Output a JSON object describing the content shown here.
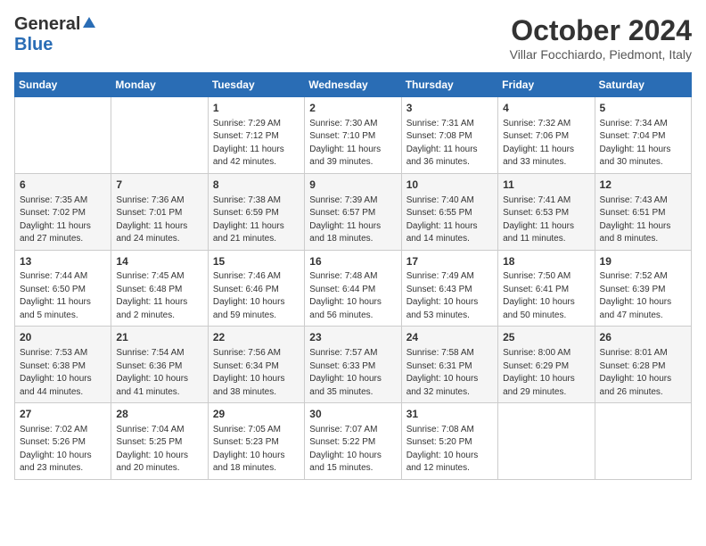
{
  "logo": {
    "general": "General",
    "blue": "Blue"
  },
  "title": "October 2024",
  "location": "Villar Focchiardo, Piedmont, Italy",
  "days_of_week": [
    "Sunday",
    "Monday",
    "Tuesday",
    "Wednesday",
    "Thursday",
    "Friday",
    "Saturday"
  ],
  "weeks": [
    [
      {
        "day": "",
        "info": ""
      },
      {
        "day": "",
        "info": ""
      },
      {
        "day": "1",
        "info": "Sunrise: 7:29 AM\nSunset: 7:12 PM\nDaylight: 11 hours and 42 minutes."
      },
      {
        "day": "2",
        "info": "Sunrise: 7:30 AM\nSunset: 7:10 PM\nDaylight: 11 hours and 39 minutes."
      },
      {
        "day": "3",
        "info": "Sunrise: 7:31 AM\nSunset: 7:08 PM\nDaylight: 11 hours and 36 minutes."
      },
      {
        "day": "4",
        "info": "Sunrise: 7:32 AM\nSunset: 7:06 PM\nDaylight: 11 hours and 33 minutes."
      },
      {
        "day": "5",
        "info": "Sunrise: 7:34 AM\nSunset: 7:04 PM\nDaylight: 11 hours and 30 minutes."
      }
    ],
    [
      {
        "day": "6",
        "info": "Sunrise: 7:35 AM\nSunset: 7:02 PM\nDaylight: 11 hours and 27 minutes."
      },
      {
        "day": "7",
        "info": "Sunrise: 7:36 AM\nSunset: 7:01 PM\nDaylight: 11 hours and 24 minutes."
      },
      {
        "day": "8",
        "info": "Sunrise: 7:38 AM\nSunset: 6:59 PM\nDaylight: 11 hours and 21 minutes."
      },
      {
        "day": "9",
        "info": "Sunrise: 7:39 AM\nSunset: 6:57 PM\nDaylight: 11 hours and 18 minutes."
      },
      {
        "day": "10",
        "info": "Sunrise: 7:40 AM\nSunset: 6:55 PM\nDaylight: 11 hours and 14 minutes."
      },
      {
        "day": "11",
        "info": "Sunrise: 7:41 AM\nSunset: 6:53 PM\nDaylight: 11 hours and 11 minutes."
      },
      {
        "day": "12",
        "info": "Sunrise: 7:43 AM\nSunset: 6:51 PM\nDaylight: 11 hours and 8 minutes."
      }
    ],
    [
      {
        "day": "13",
        "info": "Sunrise: 7:44 AM\nSunset: 6:50 PM\nDaylight: 11 hours and 5 minutes."
      },
      {
        "day": "14",
        "info": "Sunrise: 7:45 AM\nSunset: 6:48 PM\nDaylight: 11 hours and 2 minutes."
      },
      {
        "day": "15",
        "info": "Sunrise: 7:46 AM\nSunset: 6:46 PM\nDaylight: 10 hours and 59 minutes."
      },
      {
        "day": "16",
        "info": "Sunrise: 7:48 AM\nSunset: 6:44 PM\nDaylight: 10 hours and 56 minutes."
      },
      {
        "day": "17",
        "info": "Sunrise: 7:49 AM\nSunset: 6:43 PM\nDaylight: 10 hours and 53 minutes."
      },
      {
        "day": "18",
        "info": "Sunrise: 7:50 AM\nSunset: 6:41 PM\nDaylight: 10 hours and 50 minutes."
      },
      {
        "day": "19",
        "info": "Sunrise: 7:52 AM\nSunset: 6:39 PM\nDaylight: 10 hours and 47 minutes."
      }
    ],
    [
      {
        "day": "20",
        "info": "Sunrise: 7:53 AM\nSunset: 6:38 PM\nDaylight: 10 hours and 44 minutes."
      },
      {
        "day": "21",
        "info": "Sunrise: 7:54 AM\nSunset: 6:36 PM\nDaylight: 10 hours and 41 minutes."
      },
      {
        "day": "22",
        "info": "Sunrise: 7:56 AM\nSunset: 6:34 PM\nDaylight: 10 hours and 38 minutes."
      },
      {
        "day": "23",
        "info": "Sunrise: 7:57 AM\nSunset: 6:33 PM\nDaylight: 10 hours and 35 minutes."
      },
      {
        "day": "24",
        "info": "Sunrise: 7:58 AM\nSunset: 6:31 PM\nDaylight: 10 hours and 32 minutes."
      },
      {
        "day": "25",
        "info": "Sunrise: 8:00 AM\nSunset: 6:29 PM\nDaylight: 10 hours and 29 minutes."
      },
      {
        "day": "26",
        "info": "Sunrise: 8:01 AM\nSunset: 6:28 PM\nDaylight: 10 hours and 26 minutes."
      }
    ],
    [
      {
        "day": "27",
        "info": "Sunrise: 7:02 AM\nSunset: 5:26 PM\nDaylight: 10 hours and 23 minutes."
      },
      {
        "day": "28",
        "info": "Sunrise: 7:04 AM\nSunset: 5:25 PM\nDaylight: 10 hours and 20 minutes."
      },
      {
        "day": "29",
        "info": "Sunrise: 7:05 AM\nSunset: 5:23 PM\nDaylight: 10 hours and 18 minutes."
      },
      {
        "day": "30",
        "info": "Sunrise: 7:07 AM\nSunset: 5:22 PM\nDaylight: 10 hours and 15 minutes."
      },
      {
        "day": "31",
        "info": "Sunrise: 7:08 AM\nSunset: 5:20 PM\nDaylight: 10 hours and 12 minutes."
      },
      {
        "day": "",
        "info": ""
      },
      {
        "day": "",
        "info": ""
      }
    ]
  ]
}
